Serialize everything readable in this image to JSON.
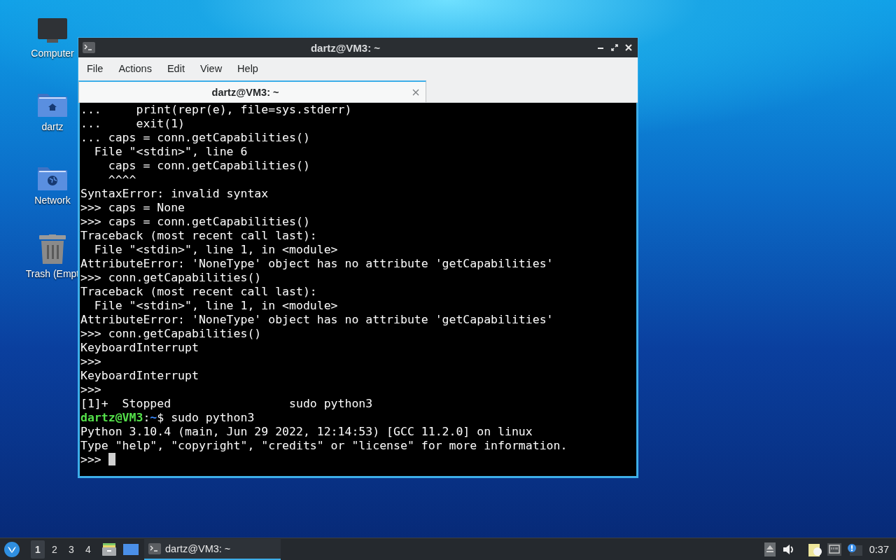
{
  "desktop_icons": [
    {
      "kind": "computer",
      "label": "Computer"
    },
    {
      "kind": "home",
      "label": "dartz"
    },
    {
      "kind": "network",
      "label": "Network"
    },
    {
      "kind": "trash",
      "label": "Trash (Empt"
    }
  ],
  "window": {
    "title": "dartz@VM3: ~",
    "menu": [
      "File",
      "Actions",
      "Edit",
      "View",
      "Help"
    ],
    "tabs": [
      {
        "label": "dartz@VM3: ~",
        "selected": true
      }
    ],
    "terminal": {
      "lines": [
        {
          "kind": "plain",
          "text": "...     print(repr(e), file=sys.stderr)"
        },
        {
          "kind": "plain",
          "text": "...     exit(1)"
        },
        {
          "kind": "plain",
          "text": "... caps = conn.getCapabilities()"
        },
        {
          "kind": "plain",
          "text": "  File \"<stdin>\", line 6"
        },
        {
          "kind": "plain",
          "text": "    caps = conn.getCapabilities()"
        },
        {
          "kind": "plain",
          "text": "    ^^^^"
        },
        {
          "kind": "plain",
          "text": "SyntaxError: invalid syntax"
        },
        {
          "kind": "plain",
          "text": ">>> caps = None"
        },
        {
          "kind": "plain",
          "text": ">>> caps = conn.getCapabilities()"
        },
        {
          "kind": "plain",
          "text": "Traceback (most recent call last):"
        },
        {
          "kind": "plain",
          "text": "  File \"<stdin>\", line 1, in <module>"
        },
        {
          "kind": "plain",
          "text": "AttributeError: 'NoneType' object has no attribute 'getCapabilities'"
        },
        {
          "kind": "plain",
          "text": ">>> conn.getCapabilities()"
        },
        {
          "kind": "plain",
          "text": "Traceback (most recent call last):"
        },
        {
          "kind": "plain",
          "text": "  File \"<stdin>\", line 1, in <module>"
        },
        {
          "kind": "plain",
          "text": "AttributeError: 'NoneType' object has no attribute 'getCapabilities'"
        },
        {
          "kind": "plain",
          "text": ">>> conn.getCapabilities()"
        },
        {
          "kind": "plain",
          "text": "KeyboardInterrupt"
        },
        {
          "kind": "plain",
          "text": ">>>"
        },
        {
          "kind": "plain",
          "text": "KeyboardInterrupt"
        },
        {
          "kind": "plain",
          "text": ">>>"
        },
        {
          "kind": "plain",
          "text": "[1]+  Stopped                 sudo python3"
        },
        {
          "kind": "prompt",
          "user": "dartz@VM3",
          "sep": ":",
          "path": "~",
          "symbol": "$",
          "command": " sudo python3"
        },
        {
          "kind": "plain",
          "text": "Python 3.10.4 (main, Jun 29 2022, 12:14:53) [GCC 11.2.0] on linux"
        },
        {
          "kind": "plain",
          "text": "Type \"help\", \"copyright\", \"credits\" or \"license\" for more information."
        },
        {
          "kind": "input",
          "text": ">>> ",
          "cursor": true
        }
      ]
    }
  },
  "taskbar": {
    "workspaces": [
      {
        "label": "1",
        "selected": true
      },
      {
        "label": "2",
        "selected": false
      },
      {
        "label": "3",
        "selected": false
      },
      {
        "label": "4",
        "selected": false
      }
    ],
    "tasks": [
      {
        "label": "dartz@VM3: ~",
        "selected": true
      }
    ],
    "clock": "0:37"
  }
}
